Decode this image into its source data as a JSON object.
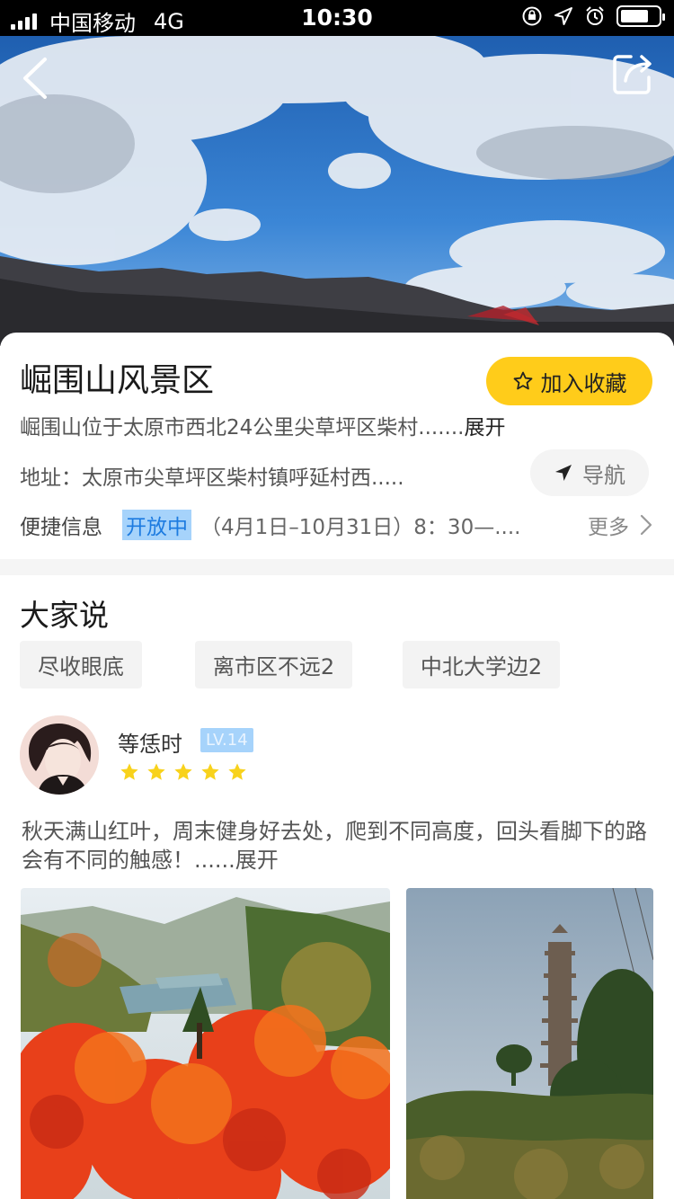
{
  "status_bar": {
    "carrier": "中国移动",
    "network": "4G",
    "time": "10:30"
  },
  "hero": {
    "back_icon": "chevron-left-icon",
    "share_icon": "share-icon"
  },
  "scenic": {
    "title": "崛围山风景区",
    "favorite_label": "加入收藏",
    "description": "崛围山位于太原市西北24公里尖草坪区柴村.......",
    "description_expand": "展开",
    "address_label": "地址：",
    "address": "太原市尖草坪区柴村镇呼延村西.....",
    "nav_label": "导航",
    "quick_label": "便捷信息",
    "open_status": "开放中",
    "open_hours": "（4月1日–10月31日）8：30—....",
    "more_label": "更多"
  },
  "reviews": {
    "section_title": "大家说",
    "tags": [
      "尽收眼底",
      "离市区不远2",
      "中北大学边2"
    ],
    "user": {
      "name": "等恁时",
      "level": "LV.14",
      "rating": 5
    },
    "text": "秋天满山红叶，周末健身好去处，爬到不同高度，回头看脚下的路会有不同的触感！......",
    "text_expand": "展开"
  },
  "colors": {
    "accent_yellow": "#ffcc1a",
    "badge_blue": "#a6d3fb",
    "star_yellow": "#f8d21c"
  }
}
